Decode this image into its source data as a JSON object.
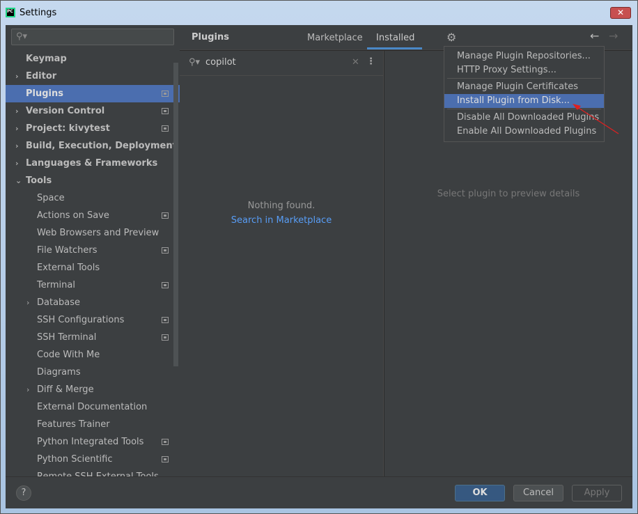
{
  "window": {
    "title": "Settings",
    "close": "✕"
  },
  "sidebar": {
    "search_placeholder": "",
    "items": [
      {
        "label": "Keymap",
        "level": 1,
        "bold": true
      },
      {
        "label": "Editor",
        "level": 1,
        "bold": true,
        "expandable": true
      },
      {
        "label": "Plugins",
        "level": 1,
        "bold": true,
        "selected": true,
        "project": true
      },
      {
        "label": "Version Control",
        "level": 1,
        "bold": true,
        "expandable": true,
        "project": true
      },
      {
        "label": "Project: kivytest",
        "level": 1,
        "bold": true,
        "expandable": true,
        "project": true
      },
      {
        "label": "Build, Execution, Deployment",
        "level": 1,
        "bold": true,
        "expandable": true
      },
      {
        "label": "Languages & Frameworks",
        "level": 1,
        "bold": true,
        "expandable": true
      },
      {
        "label": "Tools",
        "level": 1,
        "bold": true,
        "expanded": true
      },
      {
        "label": "Space",
        "level": 2
      },
      {
        "label": "Actions on Save",
        "level": 2,
        "project": true
      },
      {
        "label": "Web Browsers and Preview",
        "level": 2
      },
      {
        "label": "File Watchers",
        "level": 2,
        "project": true
      },
      {
        "label": "External Tools",
        "level": 2
      },
      {
        "label": "Terminal",
        "level": 2,
        "project": true
      },
      {
        "label": "Database",
        "level": 2,
        "expandable": true
      },
      {
        "label": "SSH Configurations",
        "level": 2,
        "project": true
      },
      {
        "label": "SSH Terminal",
        "level": 2,
        "project": true
      },
      {
        "label": "Code With Me",
        "level": 2
      },
      {
        "label": "Diagrams",
        "level": 2
      },
      {
        "label": "Diff & Merge",
        "level": 2,
        "expandable": true
      },
      {
        "label": "External Documentation",
        "level": 2
      },
      {
        "label": "Features Trainer",
        "level": 2
      },
      {
        "label": "Python Integrated Tools",
        "level": 2,
        "project": true
      },
      {
        "label": "Python Scientific",
        "level": 2,
        "project": true
      },
      {
        "label": "Remote SSH External Tools",
        "level": 2
      }
    ]
  },
  "header": {
    "title": "Plugins",
    "tabs": [
      "Marketplace",
      "Installed"
    ],
    "active_tab": "Installed"
  },
  "plugin_list": {
    "search_value": "copilot",
    "empty_text": "Nothing found.",
    "link": "Search in Marketplace"
  },
  "detail": {
    "placeholder": "Select plugin to preview details"
  },
  "gear_menu": {
    "groups": [
      [
        "Manage Plugin Repositories...",
        "HTTP Proxy Settings..."
      ],
      [
        "Manage Plugin Certificates",
        "Install Plugin from Disk..."
      ],
      [
        "Disable All Downloaded Plugins",
        "Enable All Downloaded Plugins"
      ]
    ],
    "highlighted": "Install Plugin from Disk..."
  },
  "footer": {
    "help": "?",
    "ok": "OK",
    "cancel": "Cancel",
    "apply": "Apply"
  },
  "colors": {
    "accent": "#4b6eaf",
    "link": "#589df6",
    "annotation_arrow": "#e02020"
  }
}
